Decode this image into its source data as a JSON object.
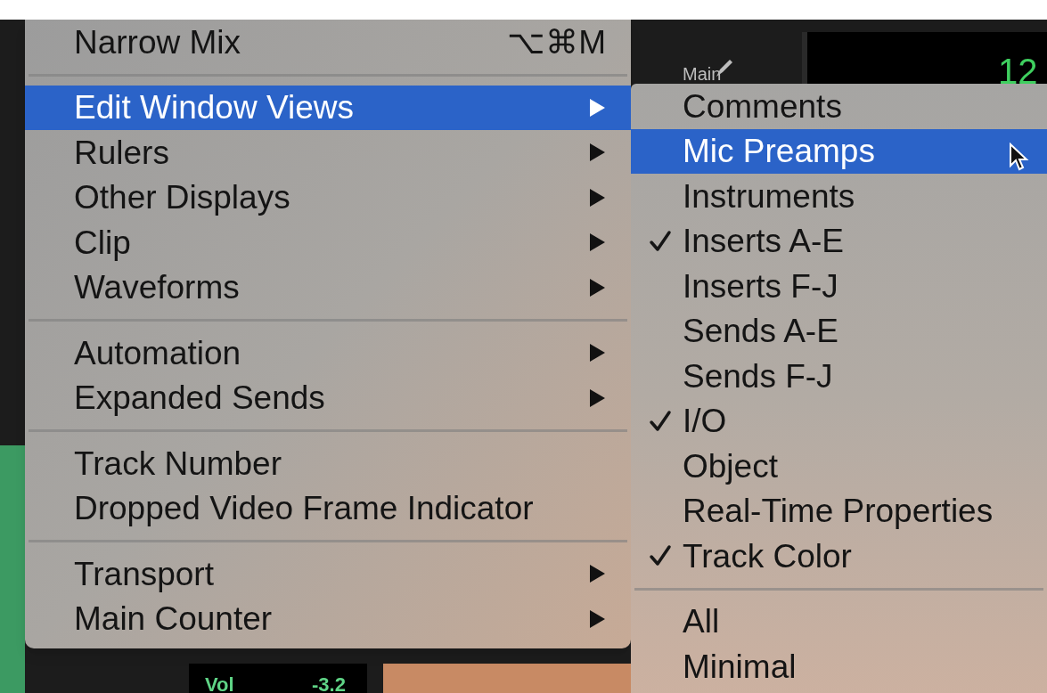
{
  "background": {
    "counter_label": "Main",
    "counter_value": "12",
    "volume_label": "Vol",
    "volume_value": "-3.2"
  },
  "menu": {
    "groups": [
      [
        {
          "label": "Narrow Mix",
          "shortcut": "⌥⌘M",
          "submenu": false,
          "selected": false
        }
      ],
      [
        {
          "label": "Edit Window Views",
          "submenu": true,
          "selected": true
        },
        {
          "label": "Rulers",
          "submenu": true,
          "selected": false
        },
        {
          "label": "Other Displays",
          "submenu": true,
          "selected": false
        },
        {
          "label": "Clip",
          "submenu": true,
          "selected": false
        },
        {
          "label": "Waveforms",
          "submenu": true,
          "selected": false
        }
      ],
      [
        {
          "label": "Automation",
          "submenu": true,
          "selected": false
        },
        {
          "label": "Expanded Sends",
          "submenu": true,
          "selected": false
        }
      ],
      [
        {
          "label": "Track Number",
          "submenu": false,
          "selected": false
        },
        {
          "label": "Dropped Video Frame Indicator",
          "submenu": false,
          "selected": false
        }
      ],
      [
        {
          "label": "Transport",
          "submenu": true,
          "selected": false
        },
        {
          "label": "Main Counter",
          "submenu": true,
          "selected": false
        }
      ]
    ]
  },
  "submenu": {
    "groups": [
      [
        {
          "label": "Comments",
          "checked": false,
          "selected": false
        },
        {
          "label": "Mic Preamps",
          "checked": false,
          "selected": true
        },
        {
          "label": "Instruments",
          "checked": false,
          "selected": false
        },
        {
          "label": "Inserts A-E",
          "checked": true,
          "selected": false
        },
        {
          "label": "Inserts F-J",
          "checked": false,
          "selected": false
        },
        {
          "label": "Sends A-E",
          "checked": false,
          "selected": false
        },
        {
          "label": "Sends F-J",
          "checked": false,
          "selected": false
        },
        {
          "label": "I/O",
          "checked": true,
          "selected": false
        },
        {
          "label": "Object",
          "checked": false,
          "selected": false
        },
        {
          "label": "Real-Time Properties",
          "checked": false,
          "selected": false
        },
        {
          "label": "Track Color",
          "checked": true,
          "selected": false
        }
      ],
      [
        {
          "label": "All",
          "checked": false,
          "selected": false
        },
        {
          "label": "Minimal",
          "checked": false,
          "selected": false
        }
      ]
    ]
  }
}
